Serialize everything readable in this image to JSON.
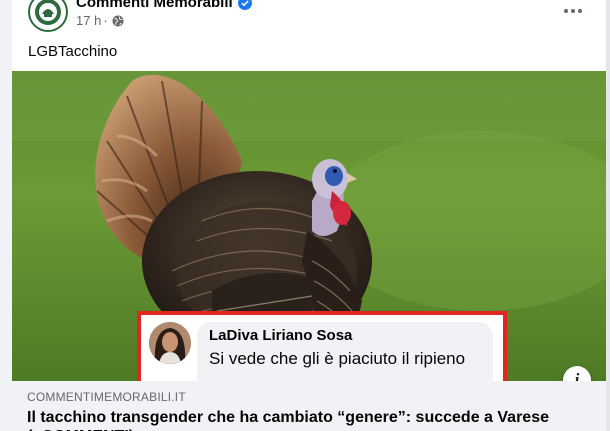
{
  "post": {
    "page_name": "Commenti Memorabili",
    "time": "17 h",
    "separator": "·",
    "caption": "LGBTacchino",
    "more_icon": "more-horizontal-icon",
    "verified_icon": "verified-badge-icon",
    "audience_icon": "globe-icon"
  },
  "image": {
    "description_icon": "info-icon",
    "info_label": "i",
    "comment": {
      "author": "LaDiva Liriano Sosa",
      "text": "Si vede che gli è piaciuto il ripieno"
    }
  },
  "link": {
    "domain": "COMMENTIMEMORABILI.IT",
    "title": "Il tacchino transgender che ha cambiato “genere”: succede a Varese (+COMMENTI)"
  },
  "colors": {
    "verified": "#1877f2",
    "highlight_border": "#e0261f",
    "link_background": "#f0f2f5"
  }
}
